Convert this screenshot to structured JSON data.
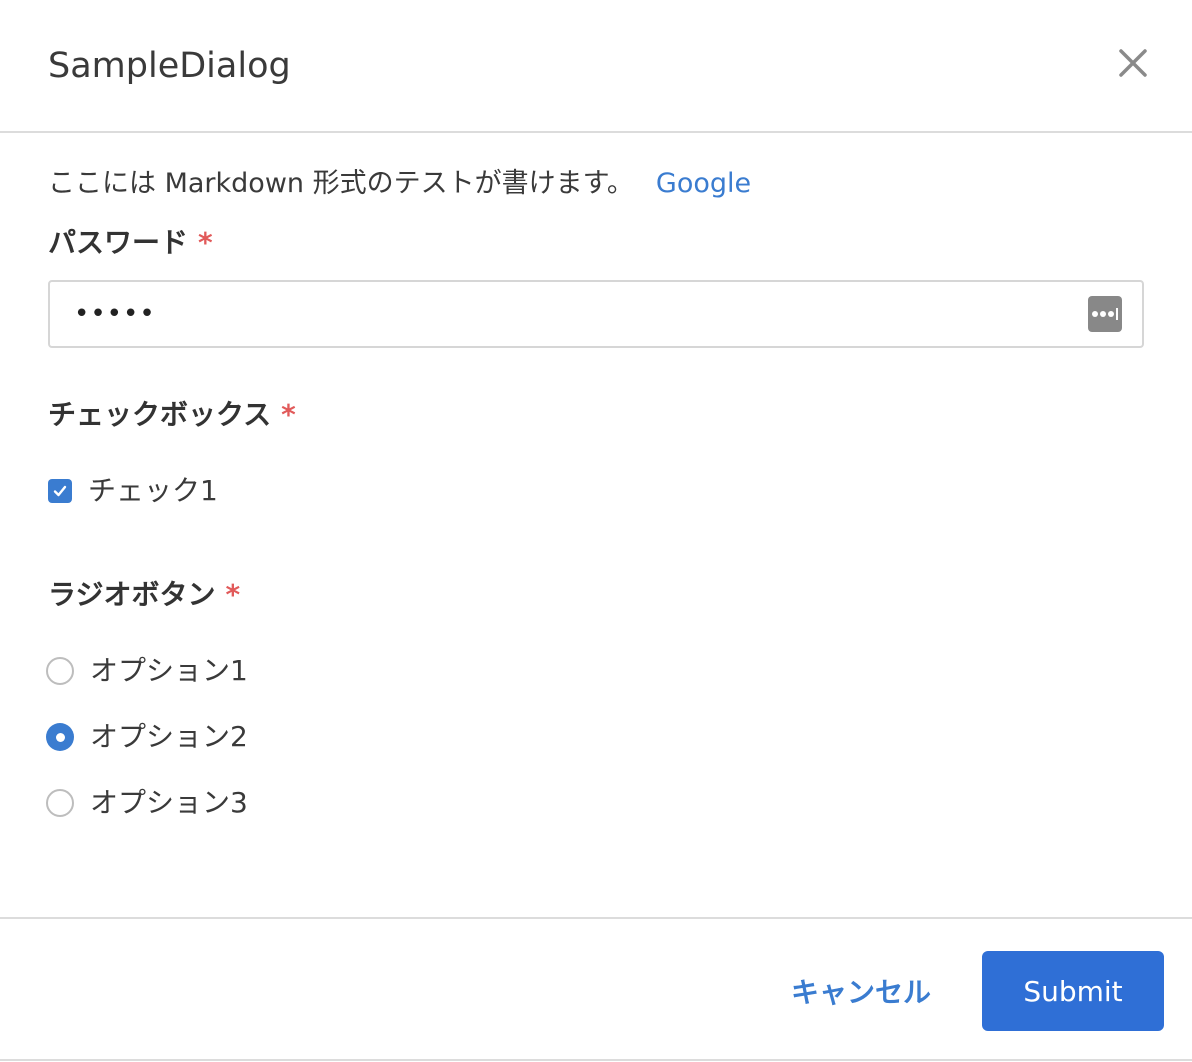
{
  "dialog": {
    "title": "SampleDialog"
  },
  "description": {
    "text": "ここには Markdown 形式のテストが書けます。",
    "link_text": "Google"
  },
  "password_field": {
    "label": "パスワード",
    "required_mark": "*",
    "masked_value": "•••••",
    "icon": "password-manager-icon"
  },
  "checkbox_group": {
    "label": "チェックボックス",
    "required_mark": "*",
    "items": [
      {
        "label": "チェック1",
        "checked": true
      }
    ]
  },
  "radio_group": {
    "label": "ラジオボタン",
    "required_mark": "*",
    "options": [
      {
        "label": "オプション1",
        "selected": false
      },
      {
        "label": "オプション2",
        "selected": true
      },
      {
        "label": "オプション3",
        "selected": false
      }
    ]
  },
  "footer": {
    "cancel_label": "キャンセル",
    "submit_label": "Submit"
  },
  "colors": {
    "accent": "#3a7cd0",
    "submit_bg": "#2f6fd6",
    "required": "#e15a5a",
    "border": "#dcdcdc"
  }
}
